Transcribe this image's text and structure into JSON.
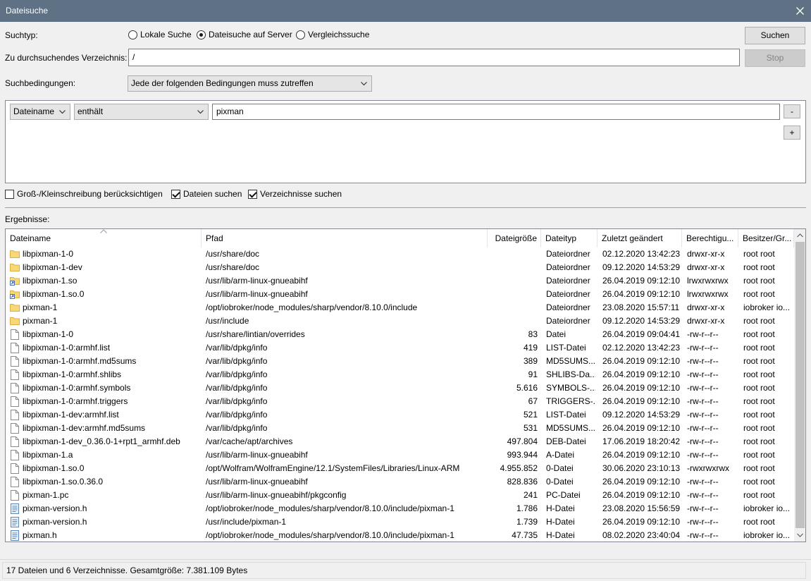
{
  "window": {
    "title": "Dateisuche"
  },
  "search_type": {
    "label": "Suchtyp:",
    "options": [
      {
        "label": "Lokale Suche",
        "selected": false
      },
      {
        "label": "Dateisuche auf Server",
        "selected": true
      },
      {
        "label": "Vergleichssuche",
        "selected": false
      }
    ]
  },
  "directory": {
    "label": "Zu durchsuchendes Verzeichnis:",
    "value": "/"
  },
  "conditions": {
    "label": "Suchbedingungen:",
    "mode": "Jede der folgenden Bedingungen muss zutreffen",
    "rows": [
      {
        "field": "Dateiname",
        "operator": "enthält",
        "value": "pixman"
      }
    ],
    "remove_label": "-",
    "add_label": "+"
  },
  "buttons": {
    "search": "Suchen",
    "stop": "Stop"
  },
  "options": [
    {
      "label": "Groß-/Kleinschreibung berücksichtigen",
      "checked": false
    },
    {
      "label": "Dateien suchen",
      "checked": true
    },
    {
      "label": "Verzeichnisse suchen",
      "checked": true
    }
  ],
  "results": {
    "label": "Ergebnisse:",
    "columns": [
      "Dateiname",
      "Pfad",
      "Dateigröße",
      "Dateityp",
      "Zuletzt geändert",
      "Berechtigu...",
      "Besitzer/Gr..."
    ],
    "rows": [
      {
        "icon": "folder-icon",
        "name": "libpixman-1-0",
        "path": "/usr/share/doc",
        "size": "",
        "type": "Dateiordner",
        "modified": "02.12.2020 13:42:23",
        "perms": "drwxr-xr-x",
        "owner": "root root"
      },
      {
        "icon": "folder-icon",
        "name": "libpixman-1-dev",
        "path": "/usr/share/doc",
        "size": "",
        "type": "Dateiordner",
        "modified": "09.12.2020 14:53:29",
        "perms": "drwxr-xr-x",
        "owner": "root root"
      },
      {
        "icon": "folder-link-icon",
        "name": "libpixman-1.so",
        "path": "/usr/lib/arm-linux-gnueabihf",
        "size": "",
        "type": "Dateiordner",
        "modified": "26.04.2019 09:12:10",
        "perms": "lrwxrwxrwx",
        "owner": "root root"
      },
      {
        "icon": "folder-link-icon",
        "name": "libpixman-1.so.0",
        "path": "/usr/lib/arm-linux-gnueabihf",
        "size": "",
        "type": "Dateiordner",
        "modified": "26.04.2019 09:12:10",
        "perms": "lrwxrwxrwx",
        "owner": "root root"
      },
      {
        "icon": "folder-icon",
        "name": "pixman-1",
        "path": "/opt/iobroker/node_modules/sharp/vendor/8.10.0/include",
        "size": "",
        "type": "Dateiordner",
        "modified": "23.08.2020 15:57:11",
        "perms": "drwxr-xr-x",
        "owner": "iobroker io..."
      },
      {
        "icon": "folder-icon",
        "name": "pixman-1",
        "path": "/usr/include",
        "size": "",
        "type": "Dateiordner",
        "modified": "09.12.2020 14:53:29",
        "perms": "drwxr-xr-x",
        "owner": "root root"
      },
      {
        "icon": "file-icon",
        "name": "libpixman-1-0",
        "path": "/usr/share/lintian/overrides",
        "size": "83",
        "type": "Datei",
        "modified": "26.04.2019 09:04:41",
        "perms": "-rw-r--r--",
        "owner": "root root"
      },
      {
        "icon": "file-icon",
        "name": "libpixman-1-0:armhf.list",
        "path": "/var/lib/dpkg/info",
        "size": "419",
        "type": "LIST-Datei",
        "modified": "02.12.2020 13:42:23",
        "perms": "-rw-r--r--",
        "owner": "root root"
      },
      {
        "icon": "file-icon",
        "name": "libpixman-1-0:armhf.md5sums",
        "path": "/var/lib/dpkg/info",
        "size": "389",
        "type": "MD5SUMS...",
        "modified": "26.04.2019 09:12:10",
        "perms": "-rw-r--r--",
        "owner": "root root"
      },
      {
        "icon": "file-icon",
        "name": "libpixman-1-0:armhf.shlibs",
        "path": "/var/lib/dpkg/info",
        "size": "91",
        "type": "SHLIBS-Da...",
        "modified": "26.04.2019 09:12:10",
        "perms": "-rw-r--r--",
        "owner": "root root"
      },
      {
        "icon": "file-icon",
        "name": "libpixman-1-0:armhf.symbols",
        "path": "/var/lib/dpkg/info",
        "size": "5.616",
        "type": "SYMBOLS-...",
        "modified": "26.04.2019 09:12:10",
        "perms": "-rw-r--r--",
        "owner": "root root"
      },
      {
        "icon": "file-icon",
        "name": "libpixman-1-0:armhf.triggers",
        "path": "/var/lib/dpkg/info",
        "size": "67",
        "type": "TRIGGERS-...",
        "modified": "26.04.2019 09:12:10",
        "perms": "-rw-r--r--",
        "owner": "root root"
      },
      {
        "icon": "file-icon",
        "name": "libpixman-1-dev:armhf.list",
        "path": "/var/lib/dpkg/info",
        "size": "521",
        "type": "LIST-Datei",
        "modified": "09.12.2020 14:53:29",
        "perms": "-rw-r--r--",
        "owner": "root root"
      },
      {
        "icon": "file-icon",
        "name": "libpixman-1-dev:armhf.md5sums",
        "path": "/var/lib/dpkg/info",
        "size": "531",
        "type": "MD5SUMS...",
        "modified": "26.04.2019 09:12:10",
        "perms": "-rw-r--r--",
        "owner": "root root"
      },
      {
        "icon": "file-icon",
        "name": "libpixman-1-dev_0.36.0-1+rpt1_armhf.deb",
        "path": "/var/cache/apt/archives",
        "size": "497.804",
        "type": "DEB-Datei",
        "modified": "17.06.2019 18:20:42",
        "perms": "-rw-r--r--",
        "owner": "root root"
      },
      {
        "icon": "file-icon",
        "name": "libpixman-1.a",
        "path": "/usr/lib/arm-linux-gnueabihf",
        "size": "993.944",
        "type": "A-Datei",
        "modified": "26.04.2019 09:12:10",
        "perms": "-rw-r--r--",
        "owner": "root root"
      },
      {
        "icon": "file-icon",
        "name": "libpixman-1.so.0",
        "path": "/opt/Wolfram/WolframEngine/12.1/SystemFiles/Libraries/Linux-ARM",
        "size": "4.955.852",
        "type": "0-Datei",
        "modified": "30.06.2020 23:10:13",
        "perms": "-rwxrwxrwx",
        "owner": "root root"
      },
      {
        "icon": "file-icon",
        "name": "libpixman-1.so.0.36.0",
        "path": "/usr/lib/arm-linux-gnueabihf",
        "size": "828.836",
        "type": "0-Datei",
        "modified": "26.04.2019 09:12:10",
        "perms": "-rw-r--r--",
        "owner": "root root"
      },
      {
        "icon": "file-icon",
        "name": "pixman-1.pc",
        "path": "/usr/lib/arm-linux-gnueabihf/pkgconfig",
        "size": "241",
        "type": "PC-Datei",
        "modified": "26.04.2019 09:12:10",
        "perms": "-rw-r--r--",
        "owner": "root root"
      },
      {
        "icon": "header-file-icon",
        "name": "pixman-version.h",
        "path": "/opt/iobroker/node_modules/sharp/vendor/8.10.0/include/pixman-1",
        "size": "1.786",
        "type": "H-Datei",
        "modified": "23.08.2020 15:56:59",
        "perms": "-rw-r--r--",
        "owner": "iobroker io..."
      },
      {
        "icon": "header-file-icon",
        "name": "pixman-version.h",
        "path": "/usr/include/pixman-1",
        "size": "1.739",
        "type": "H-Datei",
        "modified": "26.04.2019 09:12:10",
        "perms": "-rw-r--r--",
        "owner": "root root"
      },
      {
        "icon": "header-file-icon",
        "name": "pixman.h",
        "path": "/opt/iobroker/node_modules/sharp/vendor/8.10.0/include/pixman-1",
        "size": "47.735",
        "type": "H-Datei",
        "modified": "08.02.2020 23:40:04",
        "perms": "-rw-r--r--",
        "owner": "iobroker io..."
      }
    ]
  },
  "status": {
    "text": "17 Dateien und 6 Verzeichnisse. Gesamtgröße: 7.381.109 Bytes"
  }
}
